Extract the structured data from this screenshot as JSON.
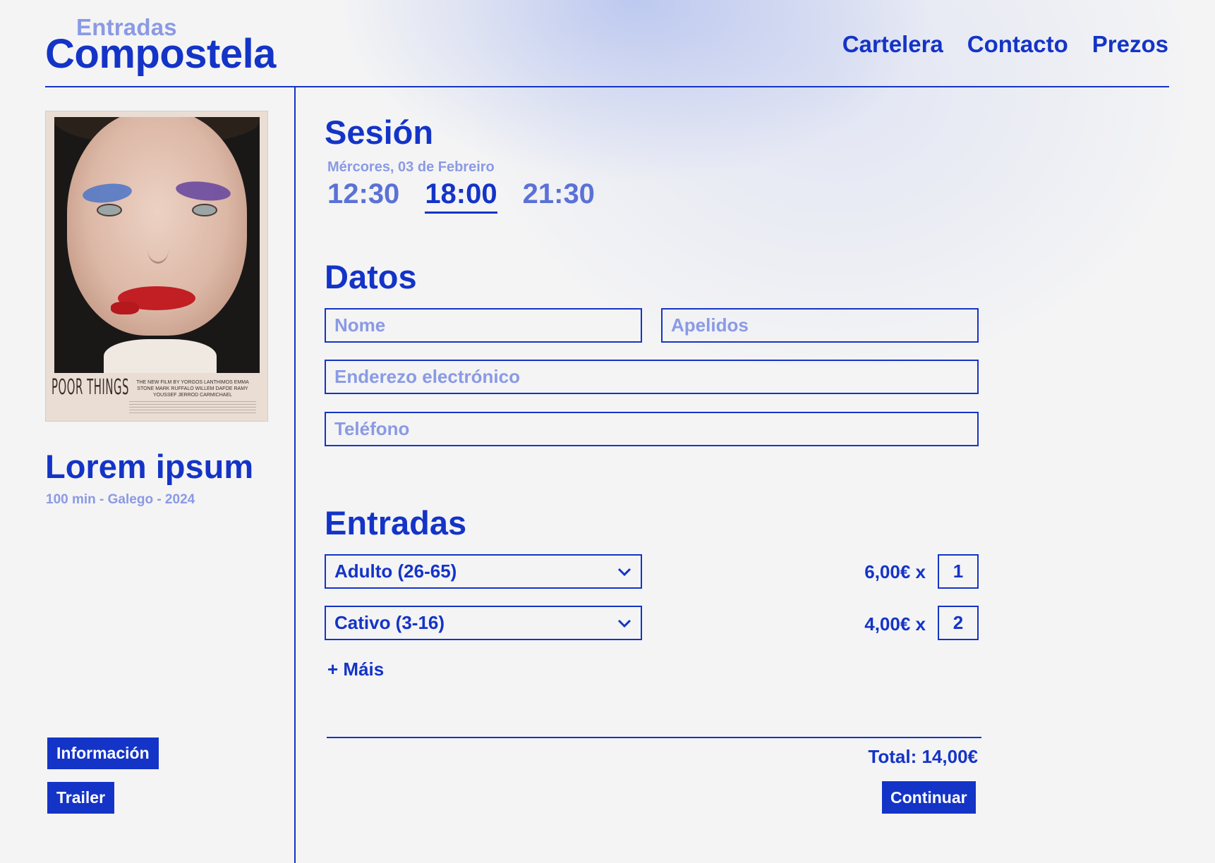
{
  "brand": {
    "top": "Entradas",
    "main": "Compostela"
  },
  "nav": {
    "items": [
      "Cartelera",
      "Contacto",
      "Prezos"
    ]
  },
  "movie": {
    "poster_title": "POOR THINGS",
    "poster_credits": "THE NEW FILM BY YORGOS LANTHIMOS  EMMA STONE  MARK RUFFALO  WILLEM DAFOE  RAMY YOUSSEF  JERROD CARMICHAEL",
    "title": "Lorem ipsum",
    "meta": "100 min - Galego - 2024",
    "info_button": "Información",
    "trailer_button": "Trailer"
  },
  "session": {
    "heading": "Sesión",
    "date": "Mércores, 03 de Febreiro",
    "times": [
      "12:30",
      "18:00",
      "21:30"
    ],
    "selected_time": "18:00"
  },
  "datos": {
    "heading": "Datos",
    "nome_placeholder": "Nome",
    "apelidos_placeholder": "Apelidos",
    "email_placeholder": "Enderezo electrónico",
    "telefono_placeholder": "Teléfono"
  },
  "entradas": {
    "heading": "Entradas",
    "rows": [
      {
        "type": "Adulto (26-65)",
        "price": "6,00€ x",
        "quantity": "1"
      },
      {
        "type": "Cativo (3-16)",
        "price": "4,00€ x",
        "quantity": "2"
      }
    ],
    "more_label": "+ Máis",
    "total": "Total: 14,00€",
    "continue_button": "Continuar"
  },
  "colors": {
    "accent": "#1434c7",
    "muted": "#8a9ae4",
    "background": "#f4f4f5"
  }
}
